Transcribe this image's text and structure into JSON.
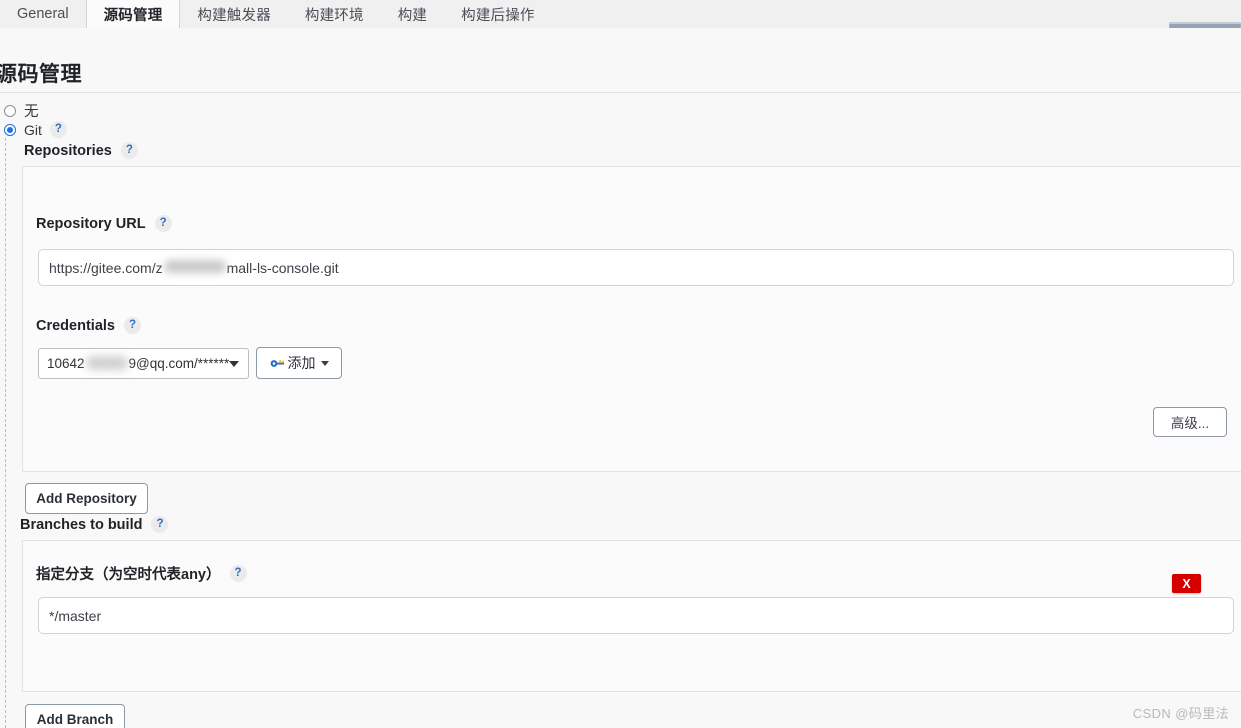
{
  "tabs": [
    {
      "label": "General",
      "active": false
    },
    {
      "label": "源码管理",
      "active": true
    },
    {
      "label": "构建触发器",
      "active": false
    },
    {
      "label": "构建环境",
      "active": false
    },
    {
      "label": "构建",
      "active": false
    },
    {
      "label": "构建后操作",
      "active": false
    }
  ],
  "page": {
    "title": "源码管理"
  },
  "scm": {
    "options": [
      {
        "label": "无",
        "selected": false
      },
      {
        "label": "Git",
        "selected": true
      }
    ],
    "git_help": "?"
  },
  "repositories": {
    "label": "Repositories",
    "help": "?",
    "repository_url": {
      "label": "Repository URL",
      "help": "?",
      "value_prefix": "https://gitee.com/z",
      "value_redacted": true,
      "value_suffix": "mall-ls-console.git"
    },
    "credentials": {
      "label": "Credentials",
      "help": "?",
      "selected_prefix": "10642",
      "selected_redacted": true,
      "selected_suffix": "9@qq.com/******",
      "add_button": "添加",
      "add_button_icon": "key-icon",
      "add_button_caret": "chevron-down-icon"
    },
    "advanced_button": "高级...",
    "add_repository_button": "Add Repository"
  },
  "branches": {
    "label": "Branches to build",
    "help": "?",
    "specifier": {
      "label": "指定分支（为空时代表any）",
      "help": "?",
      "value": "*/master"
    },
    "delete_button": "X",
    "add_branch_button": "Add Branch"
  },
  "watermark": "CSDN @码里法",
  "colors": {
    "accent_blue": "#1a73e8",
    "help_blue": "#2f6fc0",
    "delete_red": "#d40000",
    "page_bg": "#f8f8f8",
    "tabbar_bg": "#f0f0f0",
    "card_bg": "#fbfbfb"
  }
}
